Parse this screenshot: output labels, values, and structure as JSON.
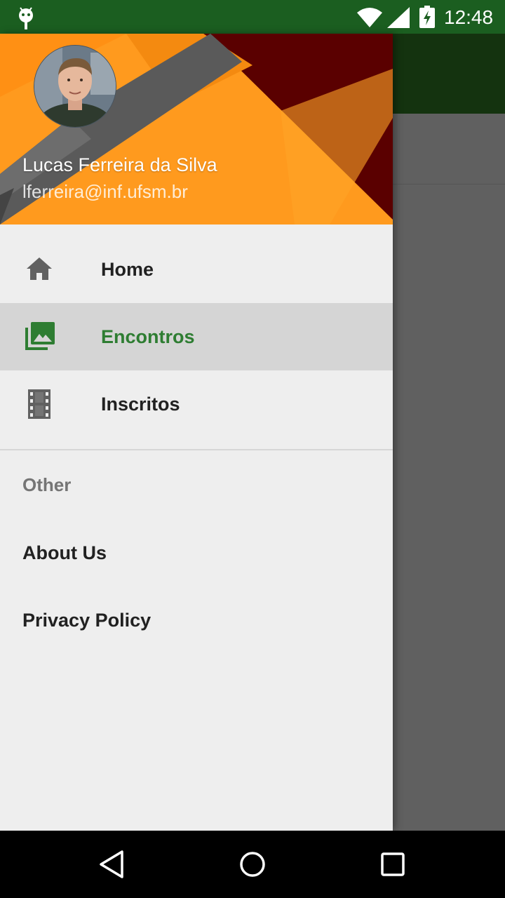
{
  "status_bar": {
    "time": "12:48",
    "icons": [
      "android-debug-icon",
      "wifi-icon",
      "signal-icon",
      "battery-charging-icon"
    ]
  },
  "drawer": {
    "header": {
      "name": "Lucas Ferreira da Silva",
      "email": "lferreira@inf.ufsm.br"
    },
    "items": [
      {
        "label": "Home",
        "icon": "home-icon",
        "selected": false
      },
      {
        "label": "Encontros",
        "icon": "photo-library-icon",
        "selected": true
      },
      {
        "label": "Inscritos",
        "icon": "film-icon",
        "selected": false
      }
    ],
    "section": {
      "title": "Other",
      "items": [
        {
          "label": "About Us"
        },
        {
          "label": "Privacy Policy"
        }
      ]
    }
  },
  "colors": {
    "status_bar": "#1b5e20",
    "accent": "#2e7d32",
    "header_orange": "#ff9a1e",
    "header_dark_red": "#5a0000",
    "drawer_bg": "#eeeeee",
    "selected_bg": "#d5d5d5"
  },
  "nav_bar": {
    "buttons": [
      "back-icon",
      "home-circle-icon",
      "recents-icon"
    ]
  }
}
